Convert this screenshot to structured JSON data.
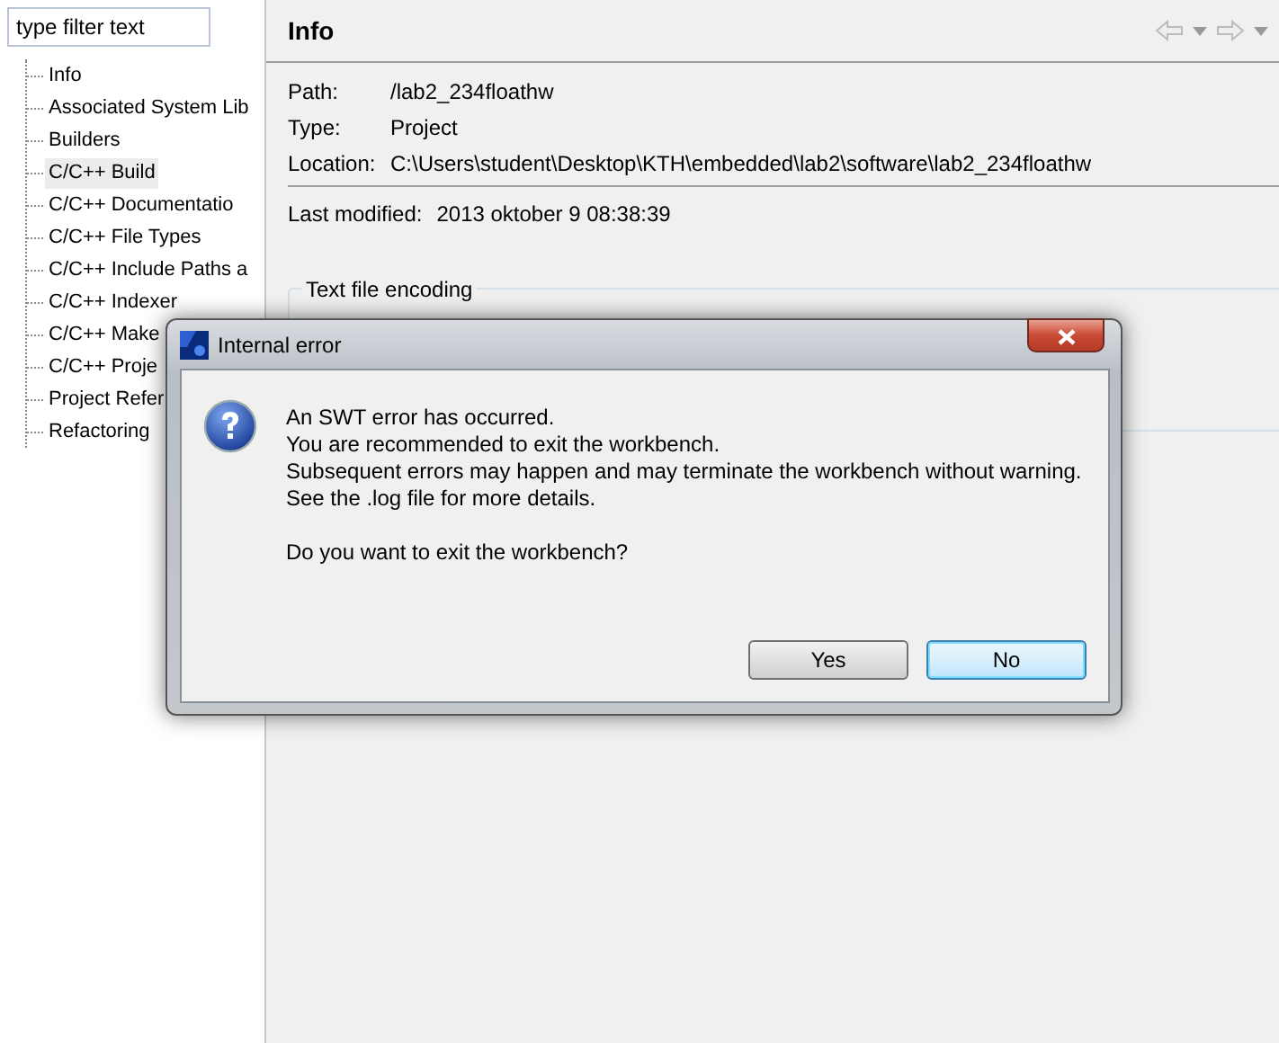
{
  "filter": {
    "placeholder": "type filter text"
  },
  "tree": [
    {
      "label": "Info",
      "selected": false
    },
    {
      "label": "Associated System Lib",
      "selected": false
    },
    {
      "label": "Builders",
      "selected": false
    },
    {
      "label": "C/C++ Build",
      "selected": true
    },
    {
      "label": "C/C++ Documentatio",
      "selected": false
    },
    {
      "label": "C/C++ File Types",
      "selected": false
    },
    {
      "label": "C/C++ Include Paths a",
      "selected": false
    },
    {
      "label": "C/C++ Indexer",
      "selected": false
    },
    {
      "label": "C/C++ Make",
      "selected": false
    },
    {
      "label": "C/C++ Proje",
      "selected": false
    },
    {
      "label": "Project Refer",
      "selected": false
    },
    {
      "label": "Refactoring",
      "selected": false
    }
  ],
  "page": {
    "title": "Info",
    "properties": [
      {
        "label": "Path:",
        "value": "/lab2_234floathw"
      },
      {
        "label": "Type:",
        "value": "Project"
      },
      {
        "label": "Location:",
        "value": "C:\\Users\\student\\Desktop\\KTH\\embedded\\lab2\\software\\lab2_234floathw"
      }
    ],
    "last_modified": {
      "label": "Last modified:",
      "value": "2013 oktober 9 08:38:39"
    },
    "group_title": "Text file encoding"
  },
  "dialog": {
    "title": "Internal error",
    "message": [
      "An SWT error has occurred.",
      "You are recommended to exit the workbench.",
      "Subsequent errors may happen and may terminate the workbench without warning.",
      "See the .log file for more details."
    ],
    "question": "Do you want to exit the workbench?",
    "buttons": [
      {
        "label": "Yes",
        "default": false
      },
      {
        "label": "No",
        "default": true
      }
    ]
  }
}
